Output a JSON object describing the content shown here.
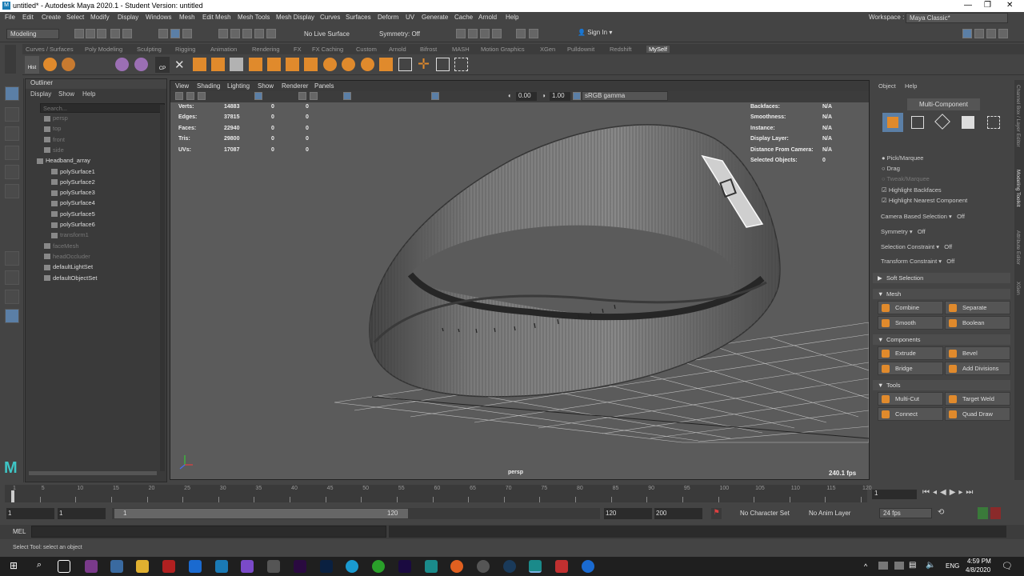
{
  "window": {
    "title": "untitled* - Autodesk Maya 2020.1 - Student Version: untitled",
    "workspace_label": "Workspace :",
    "workspace_value": "Maya Classic*"
  },
  "menu": [
    "File",
    "Edit",
    "Create",
    "Select",
    "Modify",
    "Display",
    "Windows",
    "Mesh",
    "Edit Mesh",
    "Mesh Tools",
    "Mesh Display",
    "Curves",
    "Surfaces",
    "Deform",
    "UV",
    "Generate",
    "Cache",
    "Arnold",
    "Help"
  ],
  "statusline": {
    "mode": "Modeling",
    "live_surface": "No Live Surface",
    "symmetry": "Symmetry: Off",
    "sign_in": "Sign In"
  },
  "shelf_tabs": [
    "Curves / Surfaces",
    "Poly Modeling",
    "Sculpting",
    "Rigging",
    "Animation",
    "Rendering",
    "FX",
    "FX Caching",
    "Custom",
    "Arnold",
    "Bifrost",
    "MASH",
    "Motion Graphics",
    "XGen",
    "Pulldownit",
    "Redshift",
    "MySelf"
  ],
  "shelf": {
    "hist_label": "Hist",
    "cp_label": "CP"
  },
  "outliner": {
    "title": "Outliner",
    "menu": [
      "Display",
      "Show",
      "Help"
    ],
    "search_placeholder": "Search...",
    "items": [
      {
        "label": "persp",
        "dim": true,
        "indent": 1
      },
      {
        "label": "top",
        "dim": true,
        "indent": 1
      },
      {
        "label": "front",
        "dim": true,
        "indent": 1
      },
      {
        "label": "side",
        "dim": true,
        "indent": 1
      },
      {
        "label": "Headband_array",
        "dim": false,
        "indent": 0
      },
      {
        "label": "polySurface1",
        "dim": false,
        "indent": 2
      },
      {
        "label": "polySurface2",
        "dim": false,
        "indent": 2
      },
      {
        "label": "polySurface3",
        "dim": false,
        "indent": 2
      },
      {
        "label": "polySurface4",
        "dim": false,
        "indent": 2
      },
      {
        "label": "polySurface5",
        "dim": false,
        "indent": 2
      },
      {
        "label": "polySurface6",
        "dim": false,
        "indent": 2
      },
      {
        "label": "transform1",
        "dim": true,
        "indent": 2
      },
      {
        "label": "faceMesh",
        "dim": true,
        "indent": 1
      },
      {
        "label": "headOccluder",
        "dim": true,
        "indent": 1
      },
      {
        "label": "defaultLightSet",
        "dim": false,
        "indent": 1
      },
      {
        "label": "defaultObjectSet",
        "dim": false,
        "indent": 1
      }
    ]
  },
  "viewport": {
    "menu": [
      "View",
      "Shading",
      "Lighting",
      "Show",
      "Renderer",
      "Panels"
    ],
    "exposure": "0.00",
    "gamma": "1.00",
    "colorspace": "sRGB gamma",
    "camera": "persp",
    "fps": "240.1 fps",
    "stats": [
      {
        "label": "Verts:",
        "v1": "14883",
        "v2": "0",
        "v3": "0"
      },
      {
        "label": "Edges:",
        "v1": "37815",
        "v2": "0",
        "v3": "0"
      },
      {
        "label": "Faces:",
        "v1": "22940",
        "v2": "0",
        "v3": "0"
      },
      {
        "label": "Tris:",
        "v1": "29800",
        "v2": "0",
        "v3": "0"
      },
      {
        "label": "UVs:",
        "v1": "17087",
        "v2": "0",
        "v3": "0"
      }
    ],
    "info": [
      {
        "label": "Backfaces:",
        "value": "N/A"
      },
      {
        "label": "Smoothness:",
        "value": "N/A"
      },
      {
        "label": "Instance:",
        "value": "N/A"
      },
      {
        "label": "Display Layer:",
        "value": "N/A"
      },
      {
        "label": "Distance From Camera:",
        "value": "N/A"
      },
      {
        "label": "Selected Objects:",
        "value": "0"
      }
    ]
  },
  "modeling_toolkit": {
    "menu": [
      "Object",
      "Help"
    ],
    "mode": "Multi-Component",
    "pick_marquee": "Pick/Marquee",
    "drag": "Drag",
    "tweak_marquee": "Tweak/Marquee",
    "highlight_backfaces": "Highlight Backfaces",
    "highlight_nearest": "Highlight Nearest Component",
    "camera_based_label": "Camera Based Selection",
    "camera_based_value": "Off",
    "symmetry_label": "Symmetry",
    "symmetry_value": "Off",
    "sel_constraint_label": "Selection Constraint",
    "sel_constraint_value": "Off",
    "transform_constraint_label": "Transform Constraint",
    "transform_constraint_value": "Off",
    "soft_selection": "Soft Selection",
    "sections": {
      "mesh": "Mesh",
      "components": "Components",
      "tools": "Tools"
    },
    "buttons": {
      "combine": "Combine",
      "separate": "Separate",
      "smooth": "Smooth",
      "boolean": "Boolean",
      "extrude": "Extrude",
      "bevel": "Bevel",
      "bridge": "Bridge",
      "add_divisions": "Add Divisions",
      "multi_cut": "Multi-Cut",
      "target_weld": "Target Weld",
      "connect": "Connect",
      "quad_draw": "Quad Draw"
    },
    "side_tabs": [
      "Channel Box / Layer Editor",
      "Modeling Toolkit",
      "Attribute Editor",
      "XGen"
    ]
  },
  "timeline": {
    "ticks": [
      "1",
      "5",
      "10",
      "15",
      "20",
      "25",
      "30",
      "35",
      "40",
      "45",
      "50",
      "55",
      "60",
      "65",
      "70",
      "75",
      "80",
      "85",
      "90",
      "95",
      "100",
      "105",
      "110",
      "115",
      "120"
    ],
    "current_frame": "1"
  },
  "range": {
    "start": "1",
    "start2": "1",
    "slider_start": "1",
    "slider_end": "120",
    "end": "120",
    "end2": "200",
    "char_set": "No Character Set",
    "anim_layer": "No Anim Layer",
    "fps": "24 fps"
  },
  "mel": {
    "label": "MEL"
  },
  "help_line": "Select Tool: select an object",
  "taskbar": {
    "lang": "ENG",
    "time": "4:59 PM",
    "date": "4/8/2020"
  }
}
